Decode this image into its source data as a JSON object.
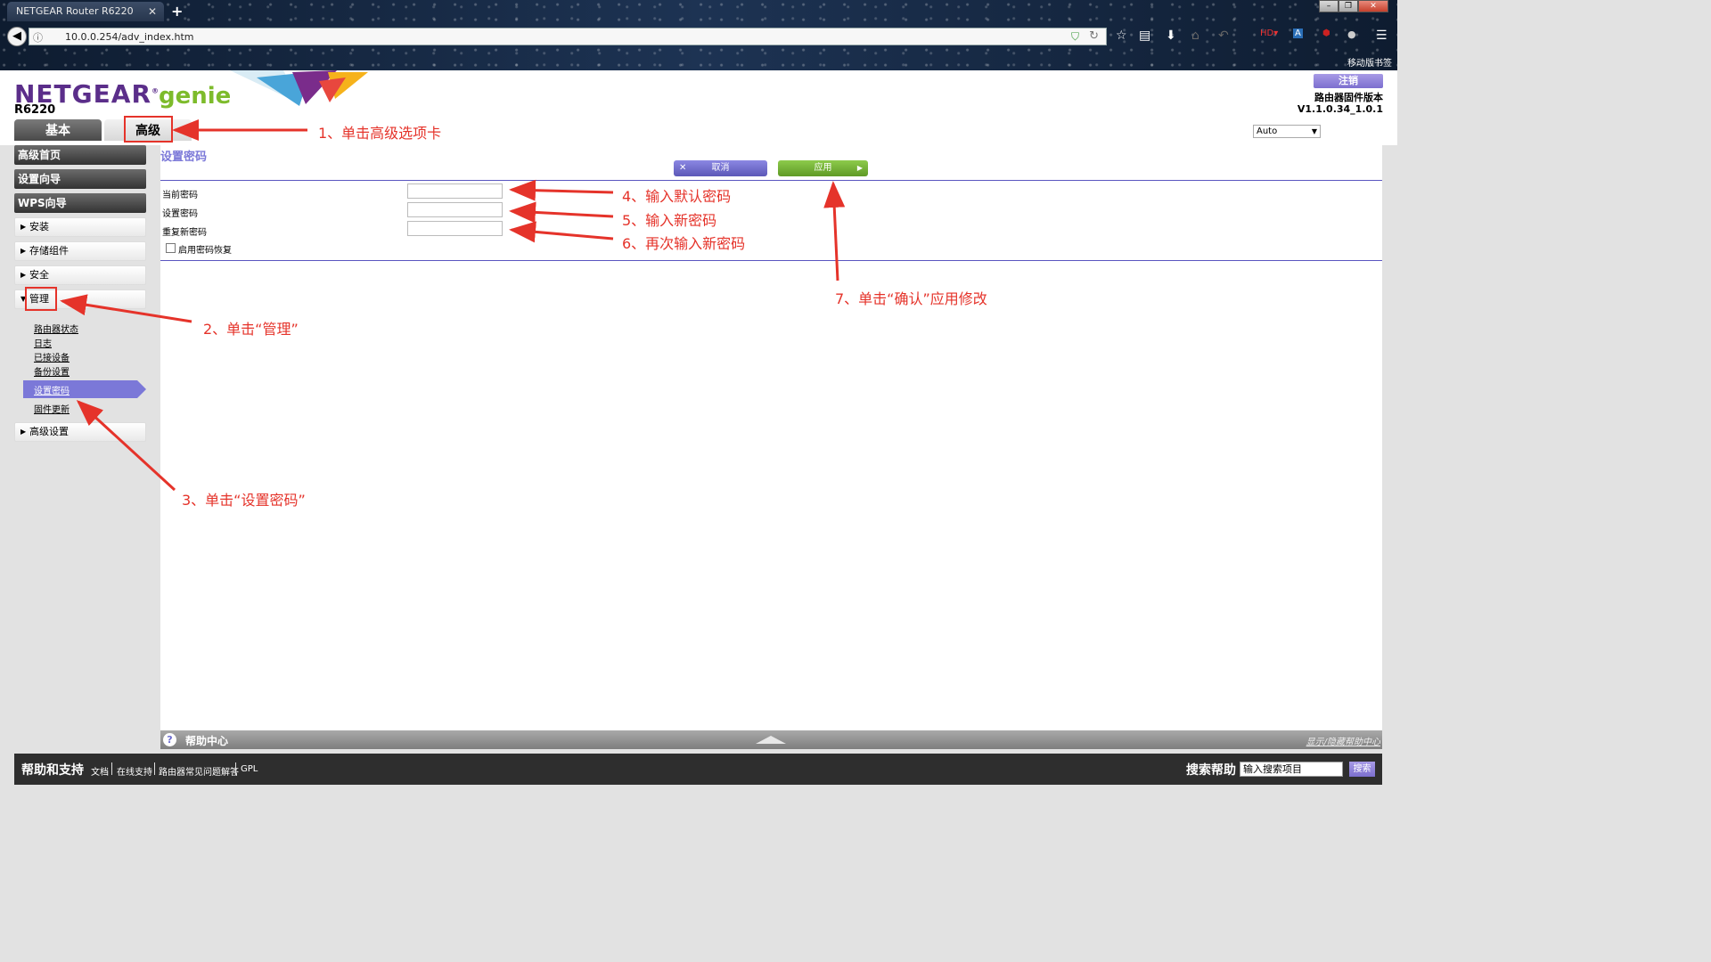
{
  "browser": {
    "tab_title": "NETGEAR Router R6220",
    "tab_close": "✕",
    "new_tab": "+",
    "url": "10.0.0.254/adv_index.htm",
    "bookmarks_label": "移动版书签",
    "window_buttons": [
      "–",
      "❐",
      "✕"
    ],
    "toolbar_icons": [
      "star-icon",
      "reading-list-icon",
      "download-icon",
      "home-icon",
      "undo-icon",
      "hd-icon",
      "addon-icon",
      "ublock-icon",
      "extension-icon",
      "menu-icon"
    ]
  },
  "header": {
    "brand": "NETGEAR",
    "brand_mark": "®",
    "genie": "genie",
    "model": "R6220",
    "logout": "注销",
    "firmware_label": "路由器固件版本",
    "firmware_version": "V1.1.0.34_1.0.1",
    "language": "Auto",
    "tabs": [
      {
        "label": "基本",
        "active": false
      },
      {
        "label": "高级",
        "active": true
      }
    ]
  },
  "sidebar": {
    "dark_items": [
      "高级首页",
      "设置向导",
      "WPS向导"
    ],
    "sections": [
      "安装",
      "存储组件",
      "安全",
      "管理"
    ],
    "admin_subitems": [
      "路由器状态",
      "日志",
      "已接设备",
      "备份设置",
      "设置密码",
      "固件更新"
    ],
    "active_subitem": "设置密码",
    "last_section": "高级设置"
  },
  "content": {
    "page_title": "设置密码",
    "cancel_button": "取消",
    "apply_button": "应用",
    "fields": [
      {
        "label": "当前密码",
        "value": ""
      },
      {
        "label": "设置密码",
        "value": ""
      },
      {
        "label": "重复新密码",
        "value": ""
      }
    ],
    "checkbox_label": "启用密码恢复",
    "checkbox_checked": false
  },
  "help": {
    "title": "帮助中心",
    "show_hide": "显示/隐藏帮助中心"
  },
  "footer": {
    "title": "帮助和支持",
    "links": [
      "文档",
      "在线支持",
      "路由器常见问题解答",
      "GPL"
    ],
    "search_label": "搜索帮助",
    "search_placeholder": "输入搜索项目",
    "search_button": "搜索"
  },
  "annotations": [
    "1、单击高级选项卡",
    "2、单击“管理”",
    "3、单击“设置密码”",
    "4、输入默认密码",
    "5、输入新密码",
    "6、再次输入新密码",
    "7、单击“确认”应用修改"
  ],
  "colors": {
    "accent_purple": "#7b78d8",
    "brand_purple": "#5b2e8a",
    "genie_green": "#7dbb2b",
    "apply_green": "#6aa82e",
    "annotation_red": "#e5332a"
  }
}
